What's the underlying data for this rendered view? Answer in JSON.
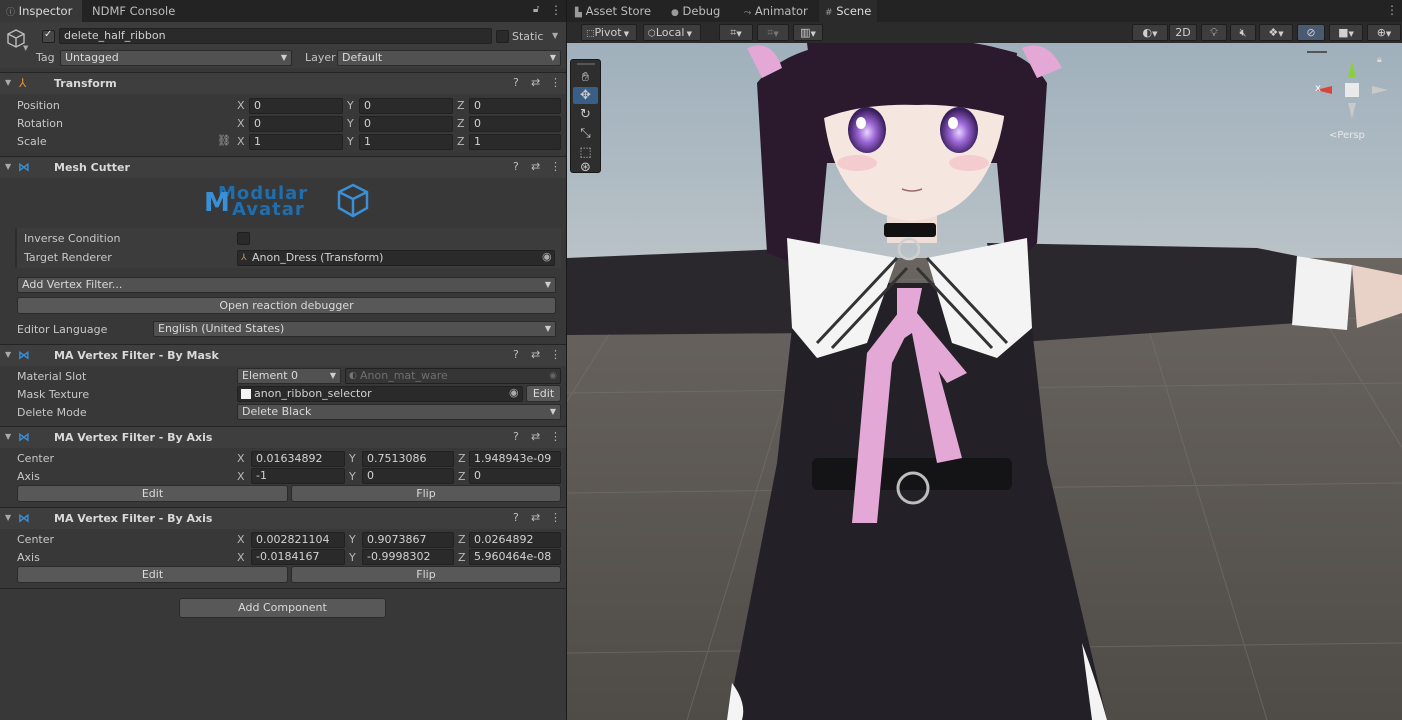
{
  "inspector": {
    "tabs": [
      "Inspector",
      "NDMF Console"
    ],
    "object": {
      "name": "delete_half_ribbon",
      "static_label": "Static",
      "tag_label": "Tag",
      "tag_value": "Untagged",
      "layer_label": "Layer",
      "layer_value": "Default"
    },
    "transform": {
      "title": "Transform",
      "position_label": "Position",
      "rotation_label": "Rotation",
      "scale_label": "Scale",
      "position": {
        "x": "0",
        "y": "0",
        "z": "0"
      },
      "rotation": {
        "x": "0",
        "y": "0",
        "z": "0"
      },
      "scale": {
        "x": "1",
        "y": "1",
        "z": "1"
      }
    },
    "mesh_cutter": {
      "title": "Mesh Cutter",
      "logo_line1": "Modular",
      "logo_line2": "Avatar",
      "inverse_label": "Inverse Condition",
      "target_label": "Target Renderer",
      "target_value": "Anon_Dress (Transform)",
      "add_filter": "Add Vertex Filter...",
      "debugger_button": "Open reaction debugger",
      "language_label": "Editor Language",
      "language_value": "English (United States)"
    },
    "mask_filter": {
      "title": "MA Vertex Filter - By Mask",
      "slot_label": "Material Slot",
      "slot_value": "Element 0",
      "material_value": "Anon_mat_ware",
      "mask_label": "Mask Texture",
      "mask_value": "anon_ribbon_selector",
      "edit_label": "Edit",
      "delete_label": "Delete Mode",
      "delete_value": "Delete Black"
    },
    "axis_filter_1": {
      "title": "MA Vertex Filter - By Axis",
      "center_label": "Center",
      "axis_label": "Axis",
      "center": {
        "x": "0.01634892",
        "y": "0.7513086",
        "z": "1.948943e-09"
      },
      "axis": {
        "x": "-1",
        "y": "0",
        "z": "0"
      },
      "edit_label": "Edit",
      "flip_label": "Flip"
    },
    "axis_filter_2": {
      "title": "MA Vertex Filter - By Axis",
      "center_label": "Center",
      "axis_label": "Axis",
      "center": {
        "x": "0.002821104",
        "y": "0.9073867",
        "z": "0.0264892"
      },
      "axis": {
        "x": "-0.0184167",
        "y": "-0.9998302",
        "z": "5.960464e-08"
      },
      "edit_label": "Edit",
      "flip_label": "Flip"
    },
    "add_component": "Add Component",
    "axis_letters": {
      "x": "X",
      "y": "Y",
      "z": "Z"
    }
  },
  "scene": {
    "tabs": [
      "Asset Store",
      "Debug",
      "Animator",
      "Scene"
    ],
    "pivot": "Pivot",
    "local": "Local",
    "mode_2d": "2D",
    "persp_label": "<Persp",
    "gizmo_x": "x"
  },
  "colors": {
    "panel_bg": "#383838",
    "accent_blue": "#3a8fd6",
    "sky": "#a9b6bf",
    "ground": "#5e5a55",
    "ribbon_pink": "#e4a8d6",
    "hair": "#2b1a2e",
    "dress": "#222026"
  }
}
